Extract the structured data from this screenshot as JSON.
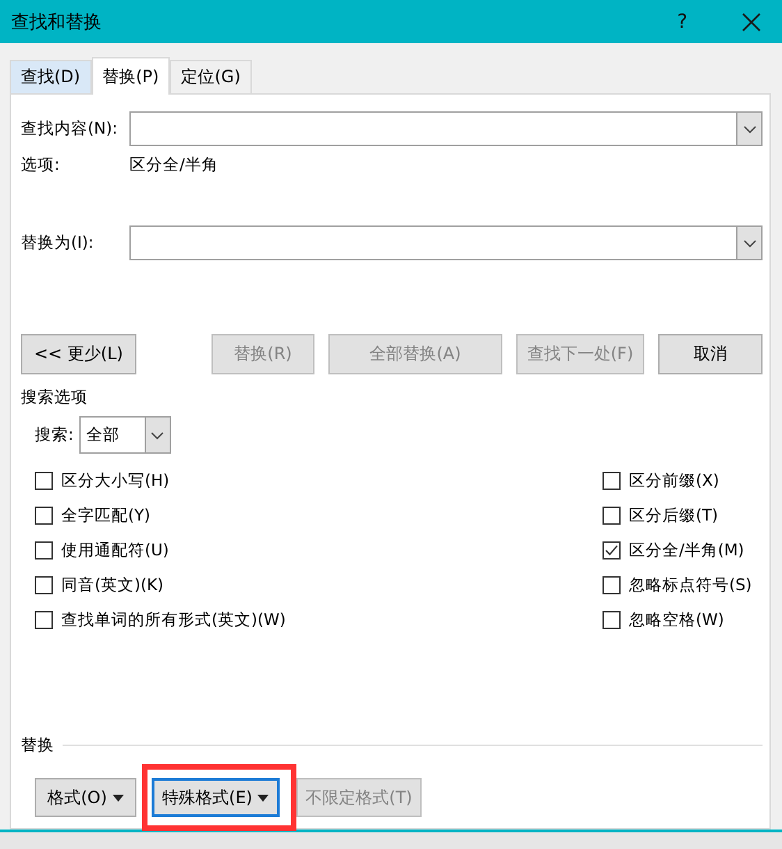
{
  "window": {
    "title": "查找和替换",
    "help": "?"
  },
  "tabs": [
    {
      "label": "查找(D)",
      "selected": false
    },
    {
      "label": "替换(P)",
      "selected": true
    },
    {
      "label": "定位(G)",
      "selected": false
    }
  ],
  "find": {
    "label": "查找内容(N):"
  },
  "options": {
    "label": "选项:",
    "value": "区分全/半角"
  },
  "replace_with": {
    "label": "替换为(I):"
  },
  "buttons": [
    {
      "label": "<< 更少(L)",
      "disabled": false
    },
    {
      "label": "替换(R)",
      "disabled": true
    },
    {
      "label": "全部替换(A)",
      "disabled": true
    },
    {
      "label": "查找下一处(F)",
      "disabled": true
    },
    {
      "label": "取消",
      "disabled": false
    }
  ],
  "search_options": {
    "title": "搜索选项",
    "search_label": "搜索:",
    "search_value": "全部",
    "left": [
      {
        "label": "区分大小写(H)",
        "checked": false
      },
      {
        "label": "全字匹配(Y)",
        "checked": false
      },
      {
        "label": "使用通配符(U)",
        "checked": false
      },
      {
        "label": "同音(英文)(K)",
        "checked": false
      },
      {
        "label": "查找单词的所有形式(英文)(W)",
        "checked": false
      }
    ],
    "right": [
      {
        "label": "区分前缀(X)",
        "checked": false
      },
      {
        "label": "区分后缀(T)",
        "checked": false
      },
      {
        "label": "区分全/半角(M)",
        "checked": true
      },
      {
        "label": "忽略标点符号(S)",
        "checked": false
      },
      {
        "label": "忽略空格(W)",
        "checked": false
      }
    ]
  },
  "replace_section": {
    "title": "替换",
    "buttons": [
      {
        "label": "格式(O)",
        "disabled": false,
        "dropdown": true,
        "focused": false,
        "highlighted": false
      },
      {
        "label": "特殊格式(E)",
        "disabled": false,
        "dropdown": true,
        "focused": true,
        "highlighted": true
      },
      {
        "label": "不限定格式(T)",
        "disabled": true,
        "dropdown": false,
        "focused": false,
        "highlighted": false
      }
    ]
  }
}
